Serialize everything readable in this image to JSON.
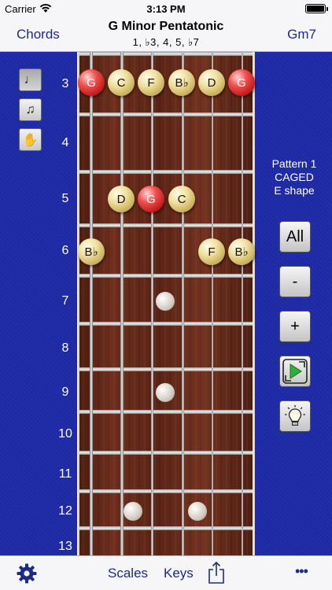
{
  "status_bar": {
    "carrier": "Carrier",
    "time": "3:13 PM",
    "battery_level": 1.0
  },
  "nav": {
    "left_label": "Chords",
    "title": "G Minor Pentatonic",
    "subtitle": "1, ♭3, 4, 5, ♭7",
    "right_label": "Gm7"
  },
  "tools": [
    {
      "icon": "quarter-note-icon",
      "glyph": "♩",
      "active": true
    },
    {
      "icon": "beamed-notes-icon",
      "glyph": "♫",
      "active": false
    },
    {
      "icon": "hand-icon",
      "glyph": "✋",
      "active": false
    }
  ],
  "fret_numbers": [
    "3",
    "4",
    "5",
    "6",
    "7",
    "8",
    "9",
    "10",
    "11",
    "12",
    "13"
  ],
  "notes": [
    {
      "label": "G",
      "fret": "3",
      "string": 1,
      "color": "red"
    },
    {
      "label": "C",
      "fret": "3",
      "string": 2,
      "color": "tan"
    },
    {
      "label": "F",
      "fret": "3",
      "string": 3,
      "color": "tan"
    },
    {
      "label": "B♭",
      "fret": "3",
      "string": 4,
      "color": "tan"
    },
    {
      "label": "D",
      "fret": "3",
      "string": 5,
      "color": "tan"
    },
    {
      "label": "G",
      "fret": "3",
      "string": 6,
      "color": "red"
    },
    {
      "label": "D",
      "fret": "5",
      "string": 2,
      "color": "tan"
    },
    {
      "label": "G",
      "fret": "5",
      "string": 3,
      "color": "red"
    },
    {
      "label": "C",
      "fret": "5",
      "string": 4,
      "color": "tan"
    },
    {
      "label": "B♭",
      "fret": "6",
      "string": 1,
      "color": "tan"
    },
    {
      "label": "F",
      "fret": "6",
      "string": 5,
      "color": "tan"
    },
    {
      "label": "B♭",
      "fret": "6",
      "string": 6,
      "color": "tan"
    }
  ],
  "pattern": {
    "line1": "Pattern 1",
    "line2": "CAGED",
    "line3": "E shape"
  },
  "side_buttons": {
    "all_label": "All",
    "minus_label": "-",
    "plus_label": "+"
  },
  "toolbar": {
    "scales_label": "Scales",
    "keys_label": "Keys",
    "more_label": "•••"
  },
  "colors": {
    "accent": "#1d2a86",
    "board_bg": "#1e2aa6",
    "root_note": "#d82020",
    "scale_note": "#e8d68a"
  }
}
